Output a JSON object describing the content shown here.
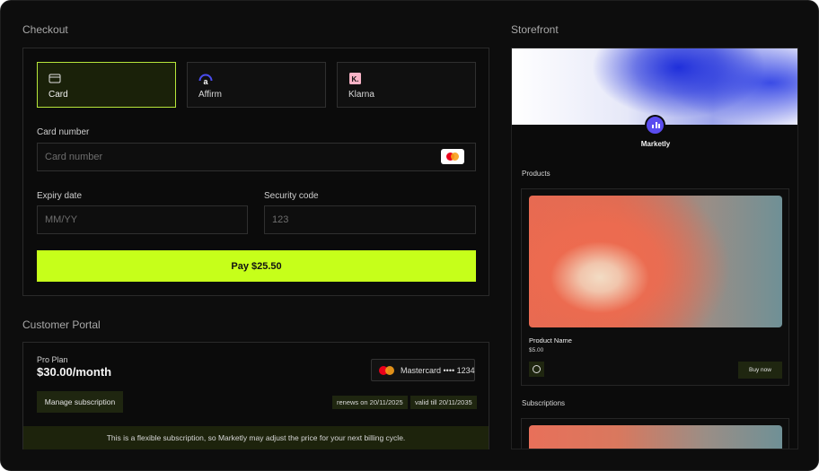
{
  "checkout": {
    "title": "Checkout",
    "payment_methods": [
      {
        "label": "Card",
        "icon": "credit-card-icon",
        "active": true
      },
      {
        "label": "Affirm",
        "icon": "affirm-logo-icon",
        "active": false
      },
      {
        "label": "Klarna",
        "icon": "klarna-logo-icon",
        "active": false
      }
    ],
    "card_number": {
      "label": "Card number",
      "placeholder": "Card number",
      "brand_icon": "mastercard-icon"
    },
    "expiry": {
      "label": "Expiry date",
      "placeholder": "MM/YY"
    },
    "security": {
      "label": "Security code",
      "placeholder": "123"
    },
    "pay_label": "Pay $25.50"
  },
  "portal": {
    "title": "Customer Portal",
    "plan_name": "Pro Plan",
    "plan_price": "$30.00/month",
    "payment_method": "Mastercard •••• 1234",
    "manage_label": "Manage subscription",
    "renews": "renews on 20/11/2025",
    "valid": "valid till 20/11/2035",
    "notice": "This is a flexible subscription, so Marketly may adjust the price for your next billing cycle."
  },
  "storefront": {
    "title": "Storefront",
    "brand": "Marketly",
    "products_heading": "Products",
    "product": {
      "name": "Product Name",
      "price": "$5.00",
      "buy_label": "Buy now"
    },
    "subscriptions_heading": "Subscriptions"
  },
  "colors": {
    "accent": "#c6ff1a",
    "active_border": "#b7e63a",
    "muted_green": "#1f2610",
    "brand_purple": "#5a4cf0",
    "background": "#0d0d0d"
  }
}
